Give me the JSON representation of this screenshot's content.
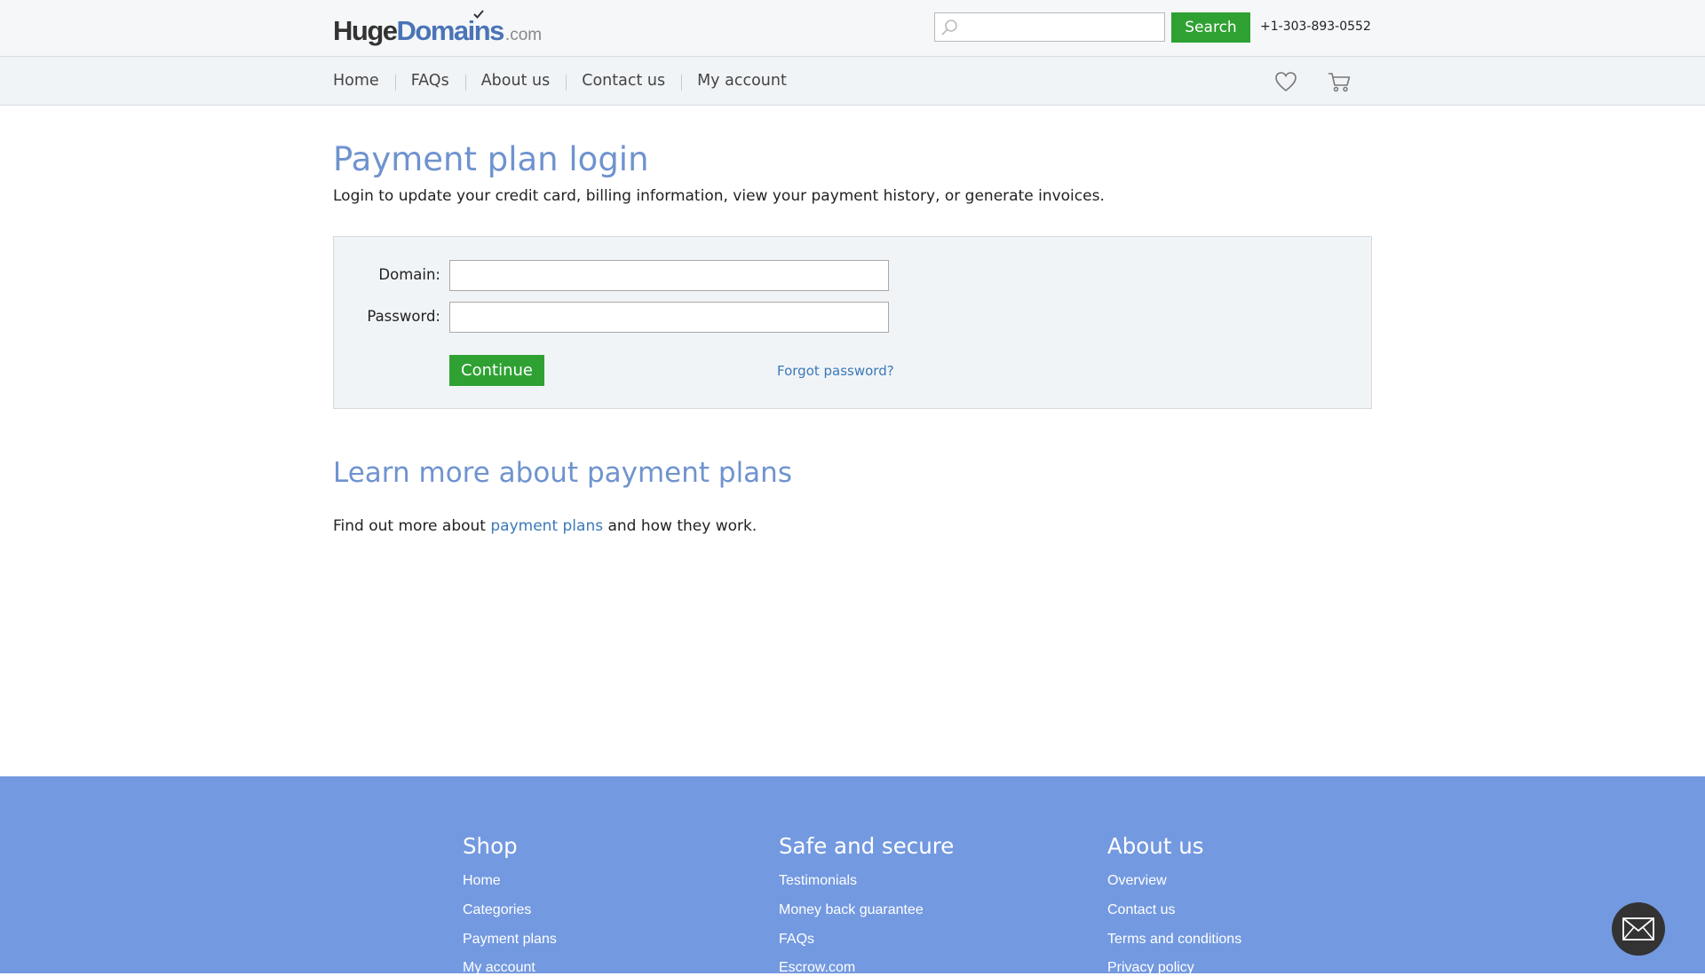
{
  "header": {
    "logo": {
      "part1": "Huge",
      "part2": "Domains",
      "part3": ".com"
    },
    "search": {
      "placeholder": "",
      "button_label": "Search"
    },
    "phone": "+1-303-893-0552"
  },
  "nav": {
    "items": [
      "Home",
      "FAQs",
      "About us",
      "Contact us",
      "My account"
    ],
    "icons": [
      "heart-icon",
      "cart-icon"
    ]
  },
  "main": {
    "title": "Payment plan login",
    "subtitle": "Login to update your credit card, billing information, view your payment history, or generate invoices.",
    "form": {
      "domain_label": "Domain:",
      "domain_value": "",
      "password_label": "Password:",
      "password_value": "",
      "continue_label": "Continue",
      "forgot_label": "Forgot password?"
    },
    "learn": {
      "title": "Learn more about payment plans",
      "text_before": "Find out more about ",
      "link_text": "payment plans",
      "text_after": " and how they work."
    }
  },
  "footer": {
    "columns": [
      {
        "title": "Shop",
        "links": [
          "Home",
          "Categories",
          "Payment plans",
          "My account"
        ]
      },
      {
        "title": "Safe and secure",
        "links": [
          "Testimonials",
          "Money back guarantee",
          "FAQs",
          "Escrow.com"
        ]
      },
      {
        "title": "About us",
        "links": [
          "Overview",
          "Contact us",
          "Terms and conditions",
          "Privacy policy"
        ]
      }
    ]
  },
  "colors": {
    "accent_green": "#2fa133",
    "title_blue": "#6f93cf",
    "link_blue": "#3b79b8",
    "footer_blue": "#7399e0"
  }
}
